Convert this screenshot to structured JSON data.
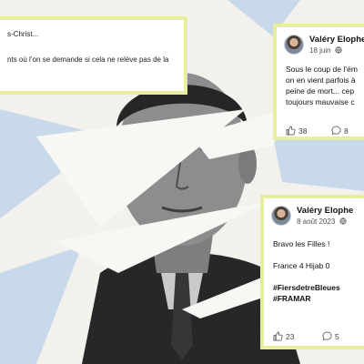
{
  "colors": {
    "background": "#f2f1ec",
    "shard_blue": "#c9d9ec",
    "card_border": "#e7eea0",
    "card_bg": "#ffffff",
    "text": "#111111"
  },
  "post_left": {
    "line1": "s-Christ...",
    "line2": "nts où l’on se demande si cela ne relève pas de la"
  },
  "post_top": {
    "author": "Valéry Elophe",
    "date": "18 juin",
    "body_lines": [
      "Sous le coup de l’ém",
      "on en vient parfois à",
      "peine de mort... cep",
      "toujours mauvaise c"
    ],
    "likes": "38",
    "comments": "8"
  },
  "post_bottom": {
    "author": "Valéry Elophe",
    "date": "8 août 2023",
    "line1": "Bravo les Filles !",
    "line2": "France 4 Hijab 0",
    "hashtag1": "#FiersdetreBleues",
    "hashtag2": "#FRAMAR",
    "likes": "23",
    "comments": "5"
  },
  "icons": [
    "globe-icon",
    "like-icon",
    "comment-icon",
    "share-icon",
    "avatar"
  ]
}
